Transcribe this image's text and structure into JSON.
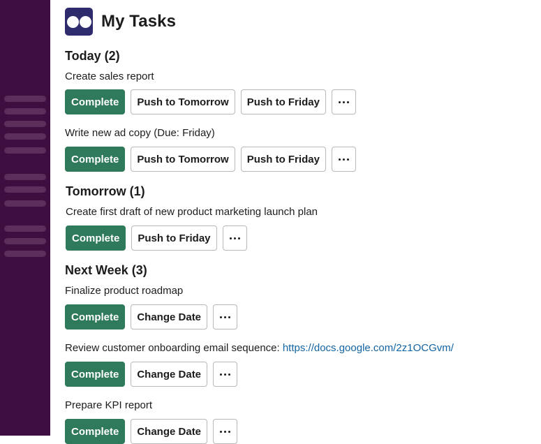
{
  "header": {
    "title": "My Tasks",
    "logo_icon": "app-logo-icon"
  },
  "colors": {
    "sidebar": "#3f0e40",
    "primary_button": "#2f7a5a",
    "link": "#1264a3",
    "logo": "#2d2b6b"
  },
  "sections": [
    {
      "heading": "Today (2)",
      "tasks": [
        {
          "text": "Create sales report",
          "buttons": [
            "Complete",
            "Push to Tomorrow",
            "Push to Friday"
          ]
        },
        {
          "text": "Write new ad copy (Due: Friday)",
          "buttons": [
            "Complete",
            "Push to Tomorrow",
            "Push to Friday"
          ]
        }
      ]
    },
    {
      "heading": "Tomorrow (1)",
      "tasks": [
        {
          "text": "Create first draft of new product marketing launch plan",
          "buttons": [
            "Complete",
            "Push to Friday"
          ]
        }
      ]
    },
    {
      "heading": "Next Week (3)",
      "tasks": [
        {
          "text": "Finalize product roadmap",
          "buttons": [
            "Complete",
            "Change Date"
          ]
        },
        {
          "text": "Review customer onboarding email sequence: ",
          "link": "https://docs.google.com/2z1OCGvm/",
          "buttons": [
            "Complete",
            "Change Date"
          ]
        },
        {
          "text": "Prepare KPI report",
          "buttons": [
            "Complete",
            "Change Date"
          ]
        }
      ]
    }
  ],
  "more_button_icon": "more-horizontal-icon"
}
